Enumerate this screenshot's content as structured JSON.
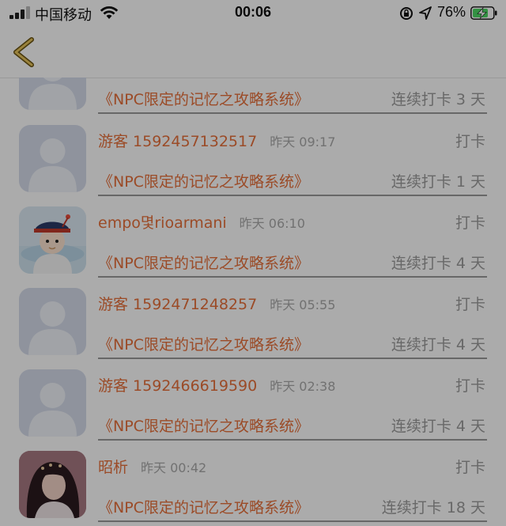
{
  "status_bar": {
    "carrier": "中国移动",
    "time": "00:06",
    "battery_percent": "76%",
    "icons": [
      "signal-icon",
      "wifi-icon",
      "rotation-lock-icon",
      "location-icon",
      "battery-charging-icon"
    ]
  },
  "nav": {
    "back_icon": "chevron-left-icon",
    "accent_color": "#c8a53a"
  },
  "colors": {
    "name": "#e8703b",
    "meta": "#a9a9a9",
    "divider": "#9a9a9a",
    "overlay": "rgba(0,0,0,0.33)"
  },
  "rows": [
    {
      "name": "",
      "time": "",
      "action": "",
      "book": "《NPC限定的记忆之攻略系统》",
      "streak": "连续打卡 3 天",
      "avatar": "default"
    },
    {
      "name": "游客 1592457132517",
      "time": "昨天 09:17",
      "action": "打卡",
      "book": "《NPC限定的记忆之攻略系统》",
      "streak": "连续打卡 1 天",
      "avatar": "default"
    },
    {
      "name": "empo몇rioarmani",
      "time": "昨天 06:10",
      "action": "打卡",
      "book": "《NPC限定的记忆之攻略系统》",
      "streak": "连续打卡 4 天",
      "avatar": "cartoon"
    },
    {
      "name": "游客 1592471248257",
      "time": "昨天 05:55",
      "action": "打卡",
      "book": "《NPC限定的记忆之攻略系统》",
      "streak": "连续打卡 4 天",
      "avatar": "default"
    },
    {
      "name": "游客 1592466619590",
      "time": "昨天 02:38",
      "action": "打卡",
      "book": "《NPC限定的记忆之攻略系统》",
      "streak": "连续打卡 4 天",
      "avatar": "default"
    },
    {
      "name": "昭析",
      "time": "昨天 00:42",
      "action": "打卡",
      "book": "《NPC限定的记忆之攻略系统》",
      "streak": "连续打卡 18 天",
      "avatar": "photo"
    }
  ]
}
